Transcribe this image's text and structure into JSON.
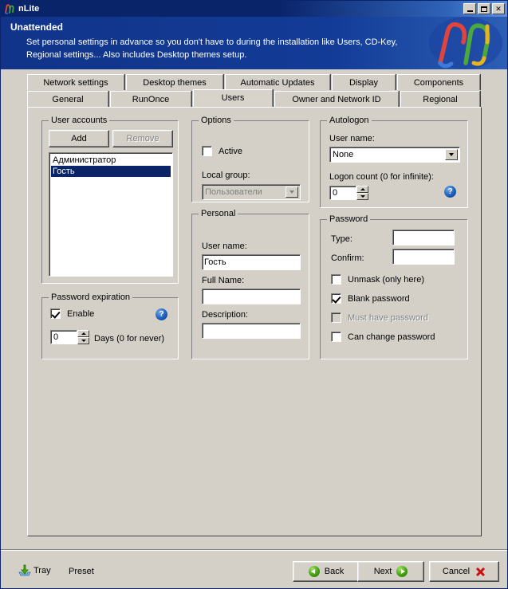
{
  "window": {
    "title": "nLite",
    "icon": "nlite-logo-icon",
    "minimize_label": "Minimize",
    "maximize_label": "Maximize",
    "close_label": "Close"
  },
  "banner": {
    "title": "Unattended",
    "line1": "Set personal settings in advance so you don't have to during the installation like Users, CD-Key,",
    "line2": "Regional settings... Also includes Desktop themes setup.",
    "logo": "nlite-n-logo",
    "bg_color": "#123b97"
  },
  "tabs": {
    "row1": [
      {
        "label": "Network settings",
        "width": 122,
        "active": false
      },
      {
        "label": "Desktop themes",
        "width": 122,
        "active": false
      },
      {
        "label": "Automatic Updates",
        "width": 132,
        "active": false
      },
      {
        "label": "Display",
        "width": 80,
        "active": false
      },
      {
        "label": "Components",
        "width": 104,
        "active": false
      }
    ],
    "row2": [
      {
        "label": "General",
        "width": 102,
        "active": false
      },
      {
        "label": "RunOnce",
        "width": 102,
        "active": false
      },
      {
        "label": "Users",
        "width": 100,
        "active": true
      },
      {
        "label": "Owner and Network ID",
        "width": 156,
        "active": false
      },
      {
        "label": "Regional",
        "width": 100,
        "active": false
      }
    ]
  },
  "user_accounts": {
    "group_label": "User accounts",
    "add_label": "Add",
    "remove_label": "Remove",
    "remove_disabled": true,
    "items": [
      {
        "label": "Администратор",
        "selected": false
      },
      {
        "label": "Гость",
        "selected": true
      }
    ]
  },
  "password_expiration": {
    "group_label": "Password expiration",
    "enable_label": "Enable",
    "enable_checked": true,
    "days_value": "0",
    "days_label": "Days (0 for never)",
    "help_glyph": "?"
  },
  "options": {
    "group_label": "Options",
    "active_label": "Active",
    "active_checked": false,
    "local_group_label": "Local group:",
    "local_group_value": "Пользователи",
    "local_group_disabled": true
  },
  "personal": {
    "group_label": "Personal",
    "user_name_label": "User name:",
    "user_name_value": "Гость",
    "full_name_label": "Full Name:",
    "full_name_value": "",
    "description_label": "Description:",
    "description_value": ""
  },
  "autologon": {
    "group_label": "Autologon",
    "user_name_label": "User name:",
    "user_name_value": "None",
    "logon_count_label": "Logon count (0 for infinite):",
    "logon_count_value": "0",
    "help_glyph": "?"
  },
  "password": {
    "group_label": "Password",
    "type_label": "Type:",
    "type_value": "",
    "confirm_label": "Confirm:",
    "confirm_value": "",
    "checks": [
      {
        "label": "Unmask (only here)",
        "checked": false,
        "disabled": false
      },
      {
        "label": "Blank password",
        "checked": true,
        "disabled": false
      },
      {
        "label": "Must have password",
        "checked": false,
        "disabled": true
      },
      {
        "label": "Can change password",
        "checked": false,
        "disabled": false
      }
    ]
  },
  "bottom": {
    "tray_label": "Tray",
    "tray_icon": "tray-download-icon",
    "preset_label": "Preset",
    "back_label": "Back",
    "back_icon": "arrow-left-circle-icon",
    "next_label": "Next",
    "next_icon": "arrow-right-circle-icon",
    "cancel_label": "Cancel",
    "cancel_icon": "red-x-icon"
  }
}
